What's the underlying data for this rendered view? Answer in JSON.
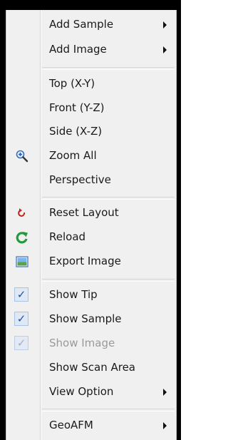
{
  "menu": {
    "items": [
      {
        "label": "Add Sample",
        "submenu": true
      },
      {
        "label": "Add Image",
        "submenu": true
      },
      {
        "label": "Top (X-Y)"
      },
      {
        "label": "Front (Y-Z)"
      },
      {
        "label": "Side (X-Z)"
      },
      {
        "label": "Zoom All",
        "icon": "zoom-in-icon"
      },
      {
        "label": "Perspective"
      },
      {
        "label": "Reset Layout",
        "icon": "reset-layout-icon"
      },
      {
        "label": "Reload",
        "icon": "reload-icon"
      },
      {
        "label": "Export Image",
        "icon": "export-image-icon"
      },
      {
        "label": "Show Tip",
        "checked": true
      },
      {
        "label": "Show Sample",
        "checked": true
      },
      {
        "label": "Show Image",
        "checked": true,
        "disabled": true
      },
      {
        "label": "Show Scan Area"
      },
      {
        "label": "View Option",
        "submenu": true
      },
      {
        "label": "GeoAFM",
        "submenu": true
      }
    ]
  },
  "colors": {
    "menu_bg": "#f0f0f0",
    "check_color": "#1f4fa0",
    "disabled_text": "#9a9a9a"
  }
}
